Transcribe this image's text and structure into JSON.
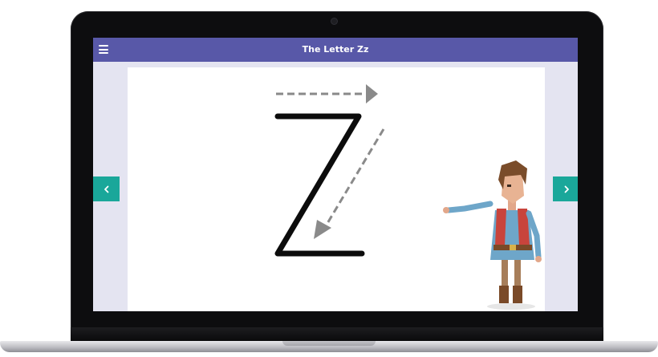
{
  "app": {
    "title": "The Letter Zz"
  },
  "header": {
    "menu_icon": "hamburger-menu-icon"
  },
  "navigation": {
    "prev_icon": "chevron-left-icon",
    "next_icon": "chevron-right-icon"
  },
  "slide": {
    "letter_shown": "Z",
    "stroke_guides": [
      "right-arrow",
      "diagonal-down-left-arrow"
    ]
  },
  "colors": {
    "header": "#5858a8",
    "nav_button": "#1aa79a",
    "screen_bg": "#e4e4f1",
    "letter": "#0c0c0c",
    "guide_arrows": "#8a8a8a"
  }
}
